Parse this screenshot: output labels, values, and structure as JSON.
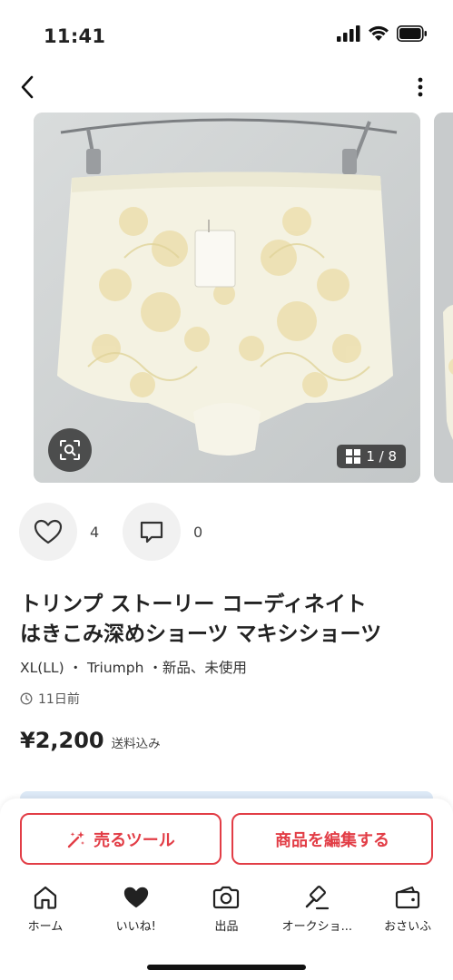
{
  "status": {
    "time": "11:41"
  },
  "nav": {
    "back_icon": "chevron-left-icon",
    "more_icon": "more-vertical-icon"
  },
  "gallery": {
    "counter": "1 / 8",
    "current_index": 1,
    "total": 8
  },
  "actions": {
    "like_count": "4",
    "comment_count": "0"
  },
  "product": {
    "title_line1": "トリンプ ストーリー コーディネイト",
    "title_line2": "はきこみ深めショーツ マキシショーツ",
    "meta": "XL(LL) ・ Triumph ・新品、未使用",
    "posted": "11日前",
    "price": "¥2,200",
    "price_note": "送料込み"
  },
  "cta": {
    "sell_tool": "売るツール",
    "edit_item": "商品を編集する"
  },
  "tabbar": {
    "items": [
      {
        "label": "ホーム",
        "icon": "home-icon"
      },
      {
        "label": "いいね!",
        "icon": "heart-filled-icon"
      },
      {
        "label": "出品",
        "icon": "camera-icon"
      },
      {
        "label": "オークショ...",
        "icon": "gavel-icon"
      },
      {
        "label": "おさいふ",
        "icon": "wallet-icon"
      }
    ]
  },
  "colors": {
    "accent": "#e23d46",
    "strip": "#dce9f6"
  }
}
